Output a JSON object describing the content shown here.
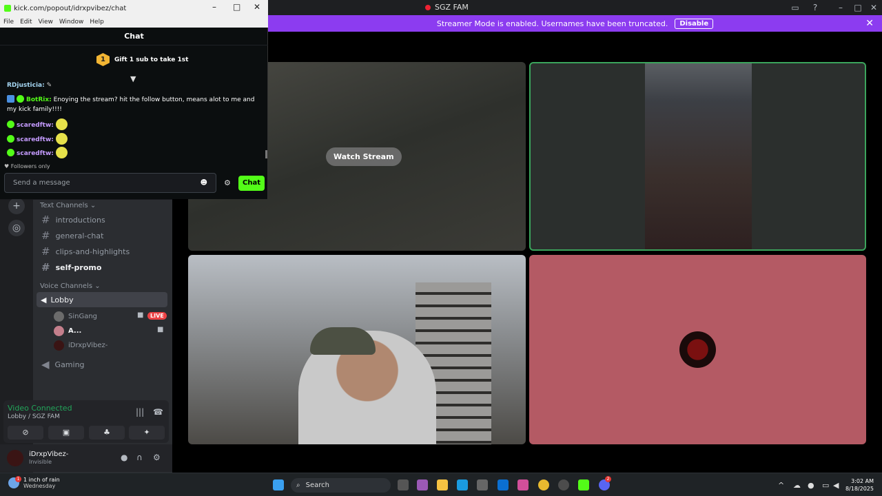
{
  "discord_window": {
    "title": "SGZ FAM",
    "banner_text": "Streamer Mode is enabled. Usernames have been truncated.",
    "banner_button": "Disable"
  },
  "stage": {
    "watch_stream_label": "Watch Stream"
  },
  "sidebar": {
    "text_channels_header": "Text Channels",
    "text_channels": [
      "introductions",
      "general-chat",
      "clips-and-highlights",
      "self-promo"
    ],
    "voice_channels_header": "Voice Channels",
    "voice_channel_active": "Lobby",
    "voice_users": [
      "SinGang",
      "A...",
      "iDrxpVibez-"
    ],
    "live_badge": "LIVE",
    "voice_channel_other": "Gaming"
  },
  "voice_panel": {
    "status": "Video Connected",
    "location": "Lobby / SGZ FAM"
  },
  "user_panel": {
    "username": "iDrxpVibez-",
    "status": "Invisible"
  },
  "kick_popout": {
    "url": "kick.com/popout/idrxpvibez/chat",
    "menu": [
      "File",
      "Edit",
      "View",
      "Window",
      "Help"
    ],
    "header": "Chat",
    "gift_rank": "1",
    "gift_text": "Gift 1 sub to take 1st",
    "messages": [
      {
        "user": "RDjusticia:",
        "text": ""
      },
      {
        "user": "BotRix:",
        "text": "Enoying the stream? hit the follow button, means alot to me and my kick family!!!!"
      },
      {
        "user": "scaredftw:",
        "text": ""
      },
      {
        "user": "scaredftw:",
        "text": ""
      },
      {
        "user": "scaredftw:",
        "text": ""
      }
    ],
    "followers_only": "Followers only",
    "input_placeholder": "Send a message",
    "chat_button": "Chat"
  },
  "taskbar": {
    "weather_line1": "1 inch of rain",
    "weather_line2": "Wednesday",
    "weather_badge": "1",
    "search_placeholder": "Search",
    "time": "3:02 AM",
    "date": "8/18/2025",
    "discord_badge": "2"
  }
}
